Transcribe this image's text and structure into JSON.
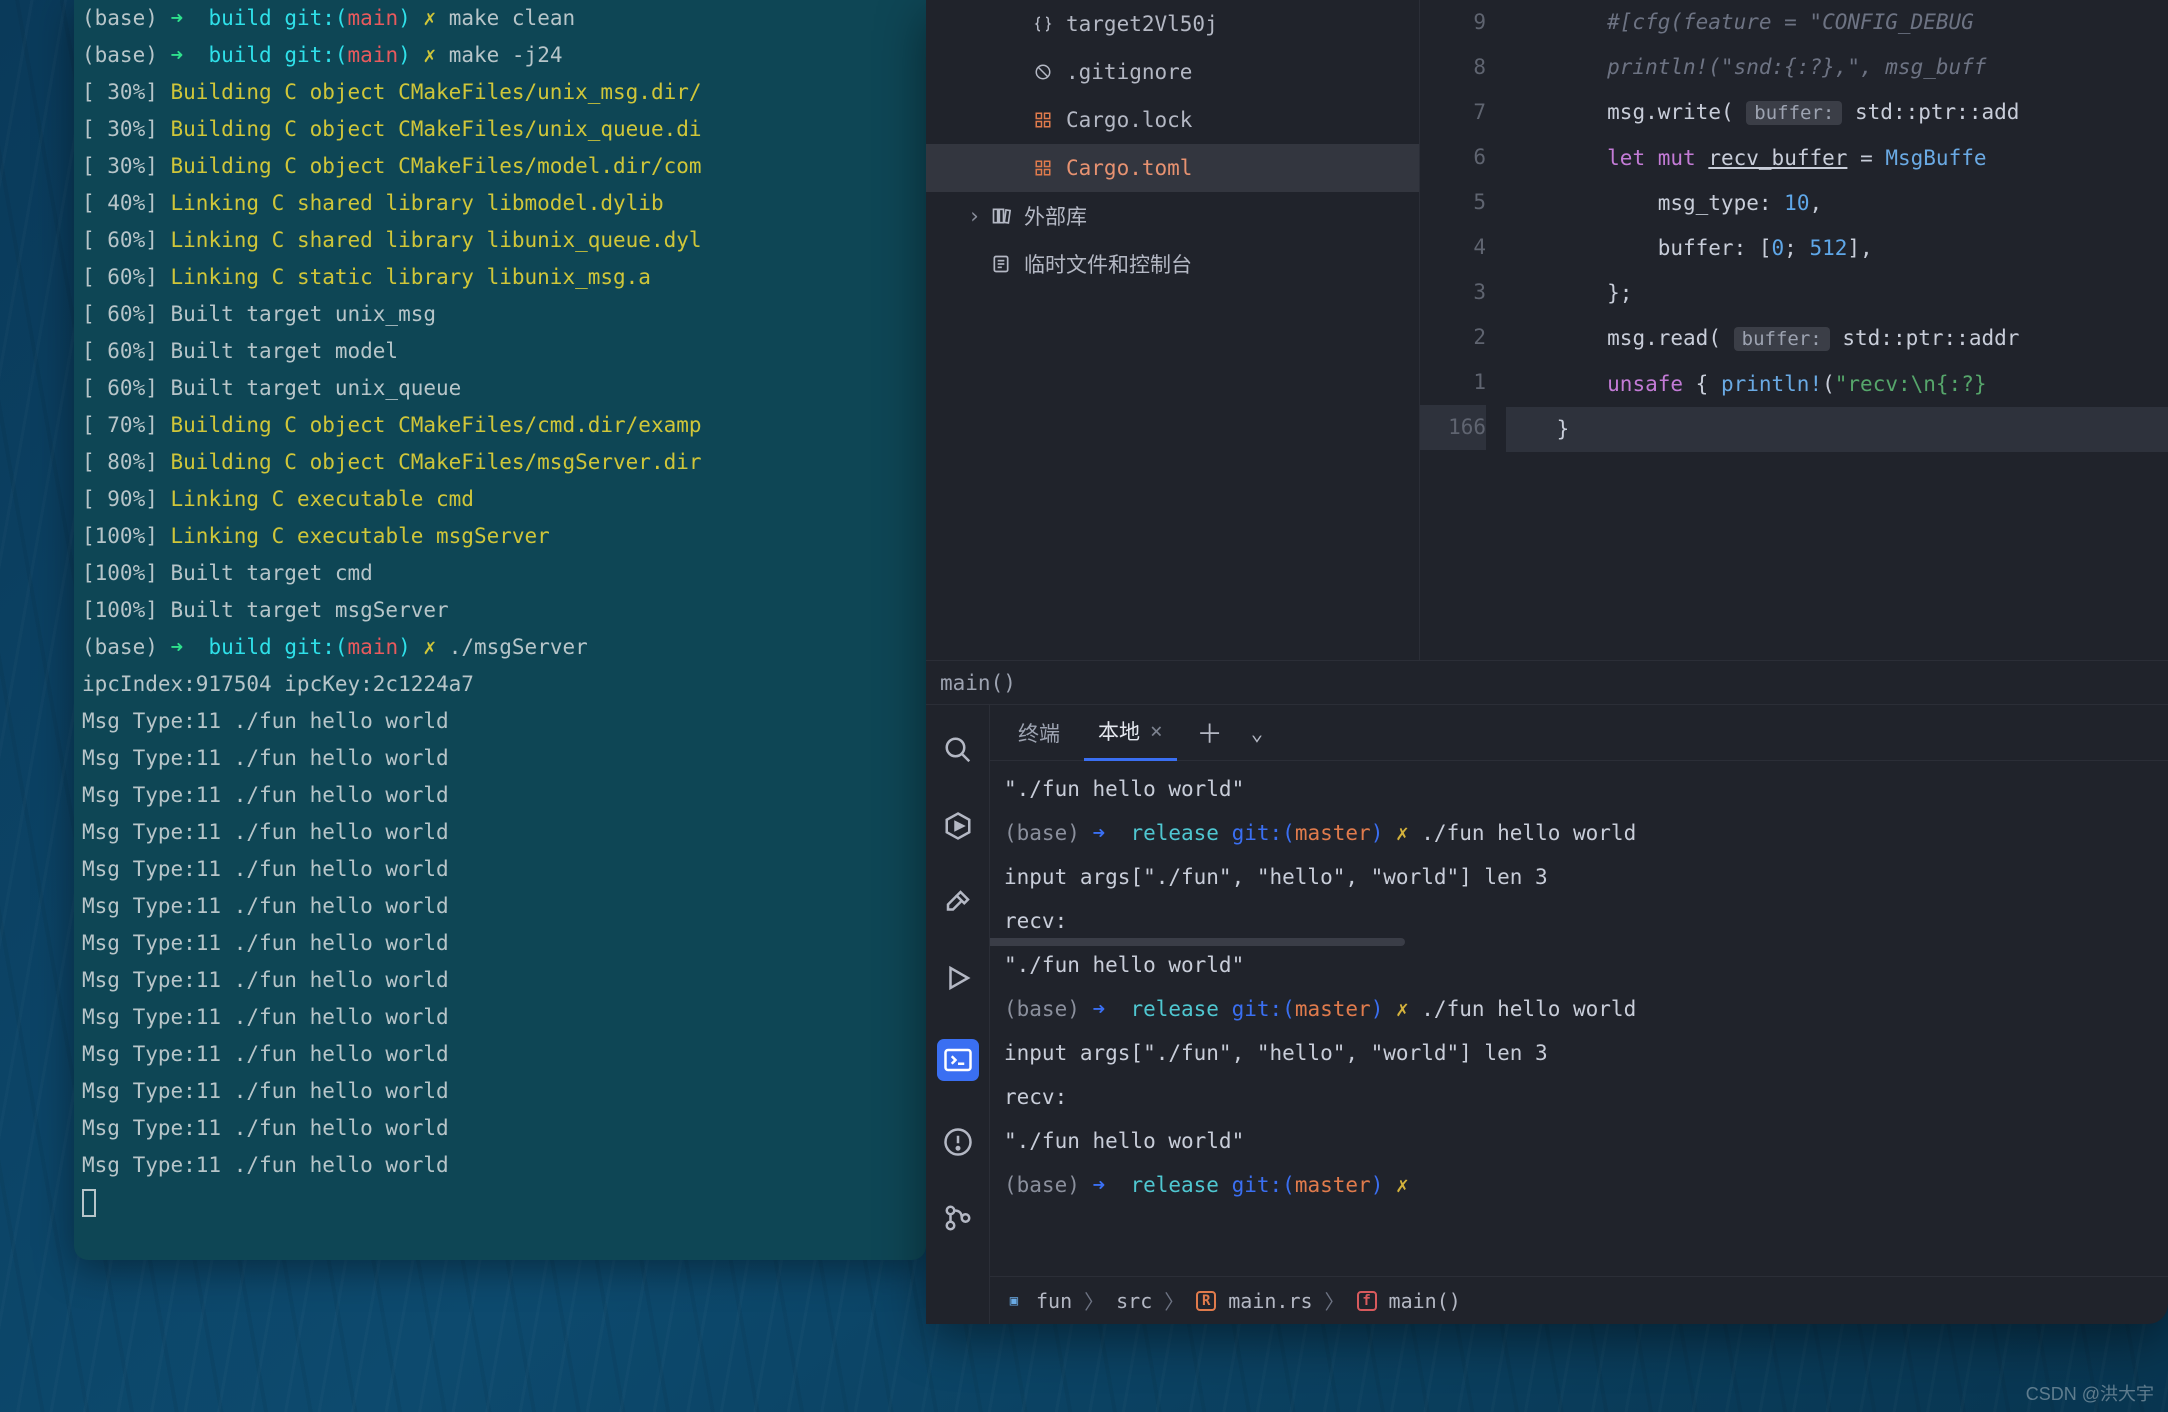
{
  "left_terminal": {
    "lines": [
      {
        "segs": [
          {
            "t": "(base) ",
            "c": "dim"
          },
          {
            "t": "➜  ",
            "c": "grn"
          },
          {
            "t": "build ",
            "c": "cyan"
          },
          {
            "t": "git:(",
            "c": "cyan"
          },
          {
            "t": "main",
            "c": "red"
          },
          {
            "t": ") ",
            "c": "cyan"
          },
          {
            "t": "✗ ",
            "c": "yel"
          },
          {
            "t": "make clean",
            "c": "dim"
          }
        ]
      },
      {
        "segs": [
          {
            "t": "(base) ",
            "c": "dim"
          },
          {
            "t": "➜  ",
            "c": "grn"
          },
          {
            "t": "build ",
            "c": "cyan"
          },
          {
            "t": "git:(",
            "c": "cyan"
          },
          {
            "t": "main",
            "c": "red"
          },
          {
            "t": ") ",
            "c": "cyan"
          },
          {
            "t": "✗ ",
            "c": "yel"
          },
          {
            "t": "make -j24",
            "c": "dim"
          }
        ]
      },
      {
        "segs": [
          {
            "t": "[ 30%] ",
            "c": "dim"
          },
          {
            "t": "Building C object CMakeFiles/unix_msg.dir/",
            "c": "yel"
          }
        ]
      },
      {
        "segs": [
          {
            "t": "[ 30%] ",
            "c": "dim"
          },
          {
            "t": "Building C object CMakeFiles/unix_queue.di",
            "c": "yel"
          }
        ]
      },
      {
        "segs": [
          {
            "t": "[ 30%] ",
            "c": "dim"
          },
          {
            "t": "Building C object CMakeFiles/model.dir/com",
            "c": "yel"
          }
        ]
      },
      {
        "segs": [
          {
            "t": "[ 40%] ",
            "c": "dim"
          },
          {
            "t": "Linking C shared library libmodel.dylib",
            "c": "yel"
          }
        ]
      },
      {
        "segs": [
          {
            "t": "[ 60%] ",
            "c": "dim"
          },
          {
            "t": "Linking C shared library libunix_queue.dyl",
            "c": "yel"
          }
        ]
      },
      {
        "segs": [
          {
            "t": "[ 60%] ",
            "c": "dim"
          },
          {
            "t": "Linking C static library libunix_msg.a",
            "c": "yel"
          }
        ]
      },
      {
        "segs": [
          {
            "t": "[ 60%] Built target unix_msg",
            "c": "dim"
          }
        ]
      },
      {
        "segs": [
          {
            "t": "[ 60%] Built target model",
            "c": "dim"
          }
        ]
      },
      {
        "segs": [
          {
            "t": "[ 60%] Built target unix_queue",
            "c": "dim"
          }
        ]
      },
      {
        "segs": [
          {
            "t": "[ 70%] ",
            "c": "dim"
          },
          {
            "t": "Building C object CMakeFiles/cmd.dir/examp",
            "c": "yel"
          }
        ]
      },
      {
        "segs": [
          {
            "t": "[ 80%] ",
            "c": "dim"
          },
          {
            "t": "Building C object CMakeFiles/msgServer.dir",
            "c": "yel"
          }
        ]
      },
      {
        "segs": [
          {
            "t": "[ 90%] ",
            "c": "dim"
          },
          {
            "t": "Linking C executable cmd",
            "c": "yel"
          }
        ]
      },
      {
        "segs": [
          {
            "t": "[100%] ",
            "c": "dim"
          },
          {
            "t": "Linking C executable msgServer",
            "c": "yel"
          }
        ]
      },
      {
        "segs": [
          {
            "t": "[100%] Built target cmd",
            "c": "dim"
          }
        ]
      },
      {
        "segs": [
          {
            "t": "[100%] Built target msgServer",
            "c": "dim"
          }
        ]
      },
      {
        "segs": [
          {
            "t": "(base) ",
            "c": "dim"
          },
          {
            "t": "➜  ",
            "c": "grn"
          },
          {
            "t": "build ",
            "c": "cyan"
          },
          {
            "t": "git:(",
            "c": "cyan"
          },
          {
            "t": "main",
            "c": "red"
          },
          {
            "t": ") ",
            "c": "cyan"
          },
          {
            "t": "✗ ",
            "c": "yel"
          },
          {
            "t": "./msgServer",
            "c": "dim"
          }
        ]
      },
      {
        "segs": [
          {
            "t": "ipcIndex:917504 ipcKey:2c1224a7",
            "c": "dim"
          }
        ]
      },
      {
        "segs": [
          {
            "t": "Msg Type:11 ./fun hello world",
            "c": "dim"
          }
        ]
      },
      {
        "segs": [
          {
            "t": "Msg Type:11 ./fun hello world",
            "c": "dim"
          }
        ]
      },
      {
        "segs": [
          {
            "t": "Msg Type:11 ./fun hello world",
            "c": "dim"
          }
        ]
      },
      {
        "segs": [
          {
            "t": "Msg Type:11 ./fun hello world",
            "c": "dim"
          }
        ]
      },
      {
        "segs": [
          {
            "t": "Msg Type:11 ./fun hello world",
            "c": "dim"
          }
        ]
      },
      {
        "segs": [
          {
            "t": "Msg Type:11 ./fun hello world",
            "c": "dim"
          }
        ]
      },
      {
        "segs": [
          {
            "t": "Msg Type:11 ./fun hello world",
            "c": "dim"
          }
        ]
      },
      {
        "segs": [
          {
            "t": "Msg Type:11 ./fun hello world",
            "c": "dim"
          }
        ]
      },
      {
        "segs": [
          {
            "t": "Msg Type:11 ./fun hello world",
            "c": "dim"
          }
        ]
      },
      {
        "segs": [
          {
            "t": "Msg Type:11 ./fun hello world",
            "c": "dim"
          }
        ]
      },
      {
        "segs": [
          {
            "t": "Msg Type:11 ./fun hello world",
            "c": "dim"
          }
        ]
      },
      {
        "segs": [
          {
            "t": "Msg Type:11 ./fun hello world",
            "c": "dim"
          }
        ]
      },
      {
        "segs": [
          {
            "t": "Msg Type:11 ./fun hello world",
            "c": "dim"
          }
        ]
      }
    ]
  },
  "tree": {
    "items": [
      {
        "icon": "braces",
        "label": "target2Vl50j",
        "indent": "ind2"
      },
      {
        "icon": "forbid",
        "label": ".gitignore",
        "indent": "ind2"
      },
      {
        "icon": "grid",
        "label": "Cargo.lock",
        "indent": "ind2"
      },
      {
        "icon": "grid",
        "label": "Cargo.toml",
        "indent": "ind2",
        "sel": true
      }
    ],
    "libs": [
      {
        "label": "外部库",
        "icon": "books"
      },
      {
        "label": "临时文件和控制台",
        "icon": "scratch"
      }
    ]
  },
  "gutter": {
    "rels": [
      "9",
      "8",
      "7",
      "6",
      "5",
      "4",
      "3",
      "2",
      "1"
    ],
    "abs": "166"
  },
  "code": [
    {
      "html": "#[cfg(feature = \"CONFIG_DEBUG",
      "cls": "cm"
    },
    {
      "html": "println!(\"snd:{:?},\", msg_buff",
      "cls": "cm"
    },
    {
      "plain": true
    },
    {
      "plain": true
    },
    {
      "plain": true
    },
    {
      "plain": true
    },
    {
      "plain": true
    },
    {
      "plain": true
    },
    {
      "plain": true
    },
    {
      "plain": true
    }
  ],
  "status_fn": "main()",
  "tabs": {
    "t1": "终端",
    "t2": "本地"
  },
  "ide_term": {
    "lines": [
      "\"./fun hello world\"",
      "PROMPT ./fun hello world",
      "input args[\"./fun\", \"hello\", \"world\"] len 3",
      "recv:",
      "\"./fun hello world\"",
      "PROMPT ./fun hello world",
      "input args[\"./fun\", \"hello\", \"world\"] len 3",
      "recv:",
      "\"./fun hello world\"",
      "PROMPT "
    ],
    "prompt": {
      "base": "(base) ",
      "arrow": "➜  ",
      "dir": "release ",
      "git": "git:(",
      "br": "master",
      "gitend": ") ",
      "x": "✗ "
    }
  },
  "crumb": {
    "a": "fun",
    "b": "src",
    "c": "main.rs",
    "d": "main()"
  },
  "watermark": "CSDN @洪大宇"
}
